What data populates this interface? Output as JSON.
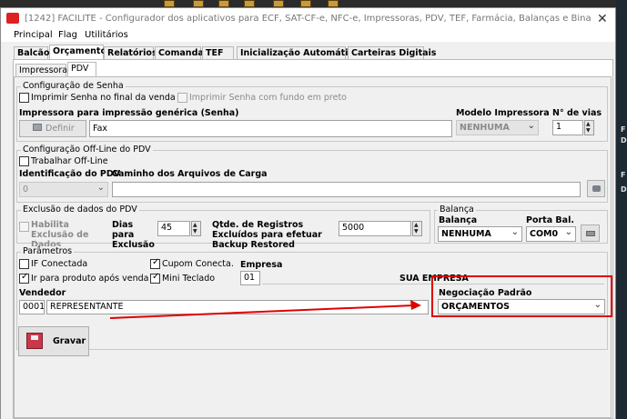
{
  "window": {
    "title": "[1242] FACILITE - Configurador dos aplicativos para ECF, SAT-CF-e, NFC-e, Impressoras, PDV, TEF, Farmácia, Balanças e Bina",
    "close_glyph": "✕"
  },
  "menu": [
    "Principal",
    "Flag",
    "Utilitários"
  ],
  "tabs": [
    "Balcão",
    "Orçamento",
    "Relatórios",
    "Comanda",
    "TEF",
    "Inicialização Automática",
    "Carteiras Digitais"
  ],
  "subtabs": [
    "Impressora",
    "PDV"
  ],
  "senha": {
    "title": "Configuração de Senha",
    "imprimir_final": "Imprimir Senha no final da venda",
    "imprimir_fundo": "Imprimir Senha com fundo em preto",
    "impressora_label": "Impressora para impressão genérica (Senha)",
    "definir": "Definir",
    "impressora_value": "Fax",
    "modelo_label": "Modelo Impressora",
    "modelo_value": "NENHUMA",
    "vias_label": "N° de vias",
    "vias_value": "1"
  },
  "offline": {
    "title": "Configuração Off-Line do PDV",
    "trabalhar": "Trabalhar Off-Line",
    "ident_label": "Identificação do PDV",
    "ident_value": "0",
    "caminho_label": "Caminho dos Arquivos de Carga",
    "caminho_value": ""
  },
  "exclusao": {
    "title": "Exclusão de dados do PDV",
    "habilita": "Habilita Exclusão de Dados",
    "dias_label": "Dias para Exclusão",
    "dias_value": "45",
    "qtde_label": "Qtde. de Registros Excluídos para efetuar Backup Restored",
    "qtde_value": "5000"
  },
  "balanca": {
    "title": "Balança",
    "balanca_label": "Balança",
    "balanca_value": "NENHUMA",
    "porta_label": "Porta Bal.",
    "porta_value": "COM0"
  },
  "parametros": {
    "title": "Parâmetros",
    "if_conectada": "IF Conectada",
    "cupom_conecta": "Cupom Conecta.",
    "ir_produto": "Ir para produto após venda",
    "mini_teclado": "Mini Teclado",
    "empresa_label": "Empresa",
    "empresa_code": "01",
    "empresa_name": "SUA EMPRESA",
    "vendedor_label": "Vendedor",
    "vendedor_code": "0001",
    "vendedor_name": "REPRESENTANTE",
    "negociacao_label": "Negociação Padrão",
    "negociacao_value": "ORÇAMENTOS"
  },
  "gravar": "Gravar",
  "desktop_right_letters": [
    "F",
    "D",
    "F",
    "D"
  ],
  "colors": {
    "highlight": "#e00000",
    "arrow": "#e00000",
    "accent": "#0078d7"
  }
}
